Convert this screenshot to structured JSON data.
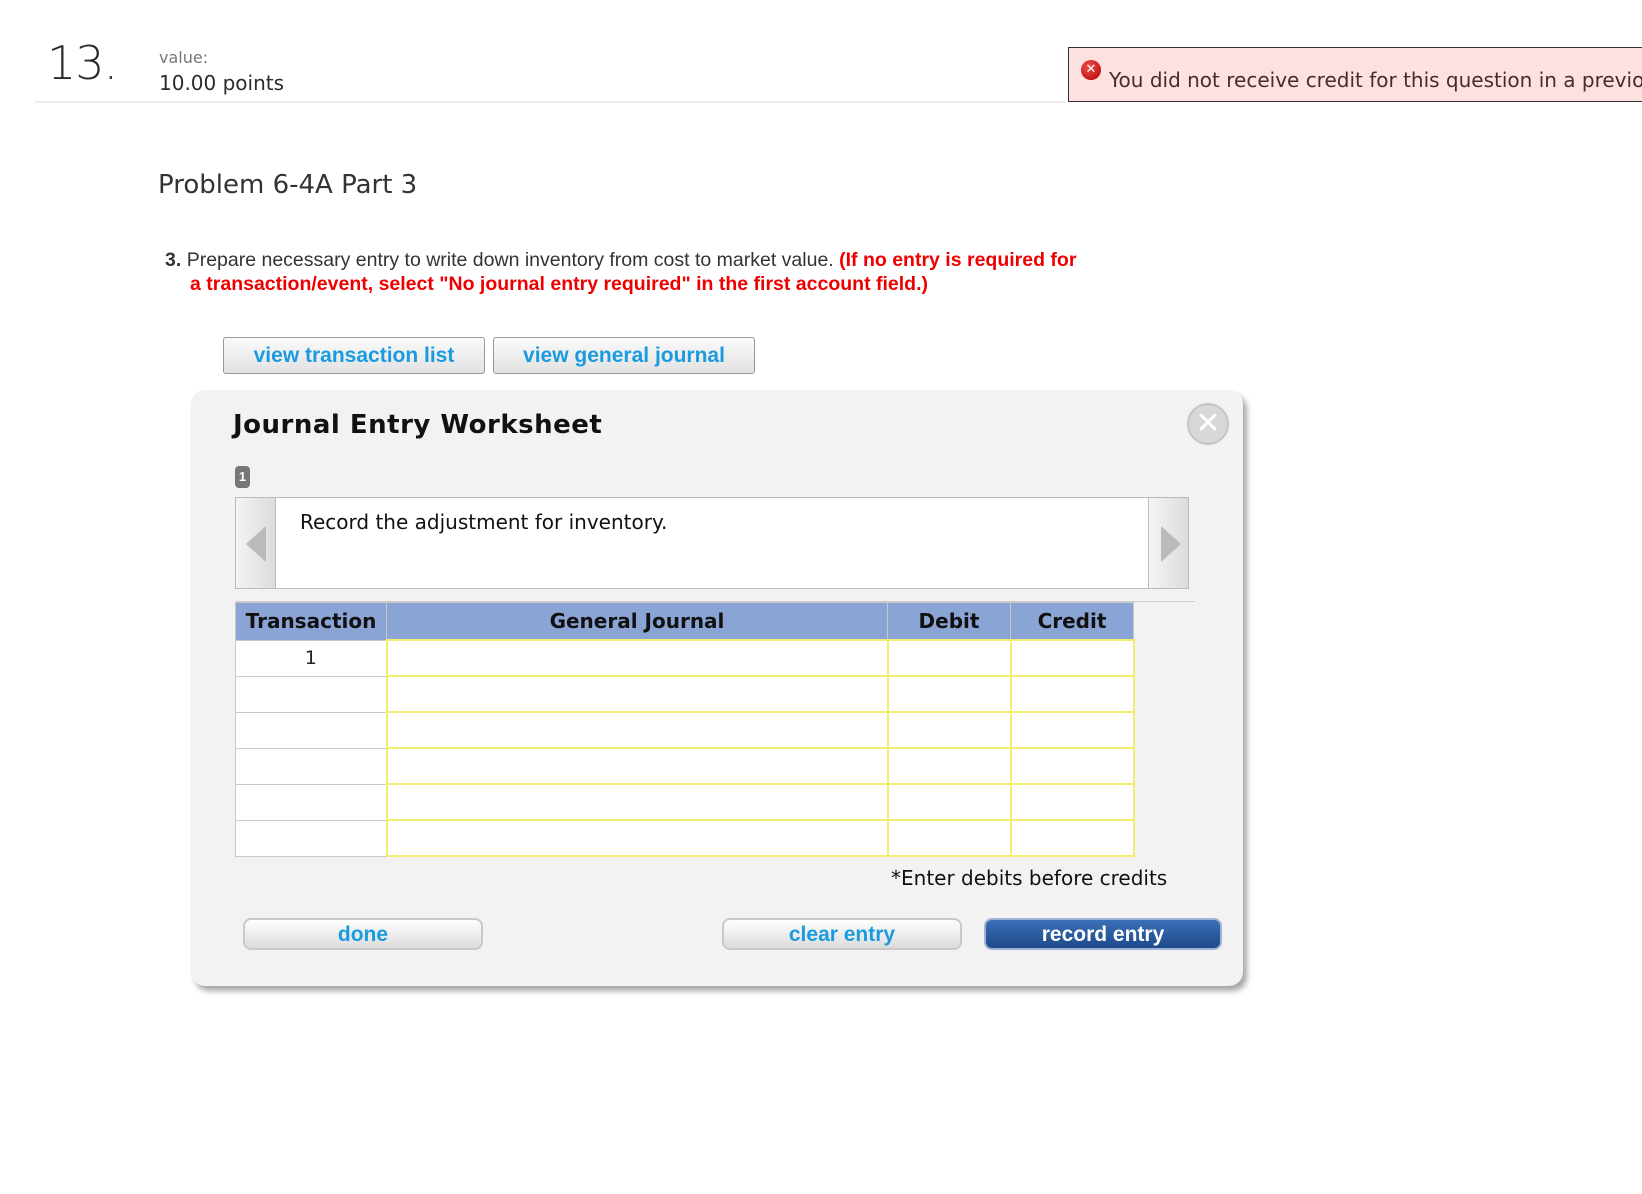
{
  "question": {
    "number": "13.",
    "value_label": "value:",
    "points": "10.00 points"
  },
  "alert": {
    "icon": "error-circle-icon",
    "icon_glyph": "✕",
    "text": "You did not receive credit for this question in a previous attempt"
  },
  "problem": {
    "title": "Problem 6-4A Part 3",
    "step_number": "3.",
    "instruction": "Prepare necessary entry to write down inventory from cost to market value.",
    "note_line1": "(If no entry is required for",
    "note_line2": "a transaction/event, select \"No journal entry required\" in the first account field.)"
  },
  "toolbar": {
    "view_transaction_list": "view transaction list",
    "view_general_journal": "view general journal"
  },
  "worksheet": {
    "title": "Journal Entry Worksheet",
    "close_glyph": "✕",
    "step_badge": "1",
    "description": "Record the adjustment for inventory.",
    "columns": [
      "Transaction",
      "General Journal",
      "Debit",
      "Credit"
    ],
    "rows": [
      {
        "transaction": "1",
        "account": "",
        "debit": "",
        "credit": ""
      },
      {
        "transaction": "",
        "account": "",
        "debit": "",
        "credit": ""
      },
      {
        "transaction": "",
        "account": "",
        "debit": "",
        "credit": ""
      },
      {
        "transaction": "",
        "account": "",
        "debit": "",
        "credit": ""
      },
      {
        "transaction": "",
        "account": "",
        "debit": "",
        "credit": ""
      },
      {
        "transaction": "",
        "account": "",
        "debit": "",
        "credit": ""
      }
    ],
    "footnote": "*Enter debits before credits",
    "buttons": {
      "done": "done",
      "clear_entry": "clear entry",
      "record_entry": "record entry"
    }
  },
  "colors": {
    "link_blue": "#1a9be0",
    "instruction_red": "#e00000",
    "header_blue": "#8aa4d6",
    "input_border_yellow": "#f0ef70",
    "record_button_blue": "#1d4a8a",
    "alert_bg": "#fde0e0"
  }
}
